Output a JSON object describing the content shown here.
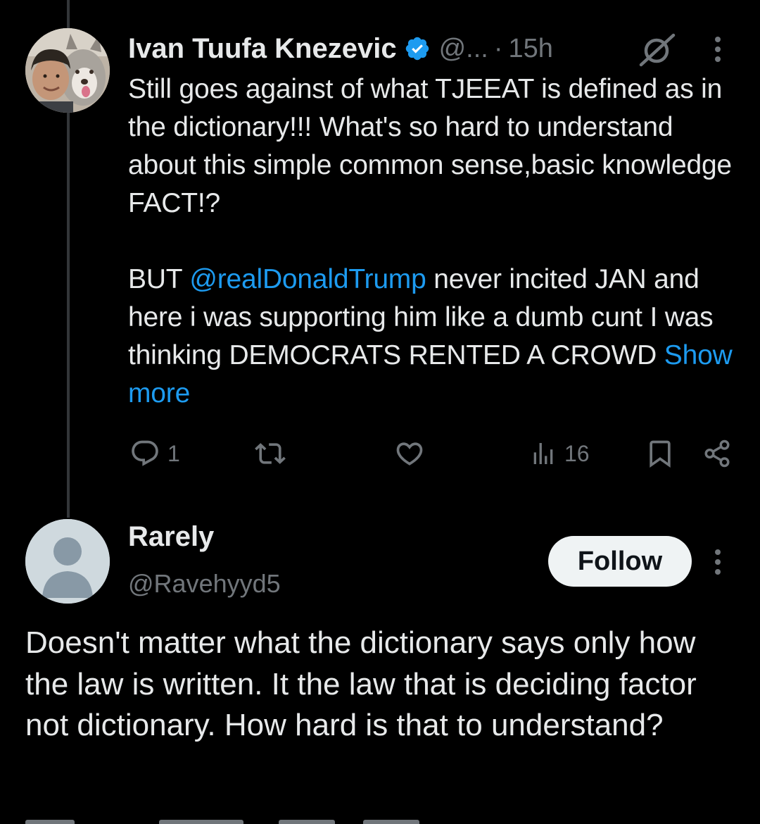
{
  "tweet": {
    "author": {
      "name": "Ivan Tuufa Knezevic",
      "handle": "@...",
      "verified": true,
      "avatar_icon": "profile-photo-with-husky-dog"
    },
    "separator": "·",
    "time": "15h",
    "text": {
      "line1": "Still goes against of what TJEEAT is defined as in the dictionary!!! What's so hard to understand about this simple common sense,basic knowledge FACT!?",
      "line2_prefix": "BUT ",
      "mention": "@realDonaldTrump",
      "line2_suffix": " never incited JAN and here i was supporting him like a dumb cunt I was thinking DEMOCRATS RENTED A CROWD ",
      "show_more": "Show more"
    },
    "actions": {
      "reply_count": "1",
      "retweet_count": "",
      "like_count": "",
      "views_count": "16"
    }
  },
  "reply": {
    "author": {
      "name": "Rarely",
      "handle": "@Ravehyyd5",
      "avatar_icon": "default-profile-icon"
    },
    "follow_label": "Follow",
    "text": "Doesn't matter what the dictionary says only how the law is written. It the law that is deciding factor not dictionary. How hard is that to understand?"
  },
  "colors": {
    "background": "#000000",
    "text": "#e7e9ea",
    "secondary": "#71767b",
    "accent": "#1d9bf0",
    "thread_line": "#333639"
  }
}
